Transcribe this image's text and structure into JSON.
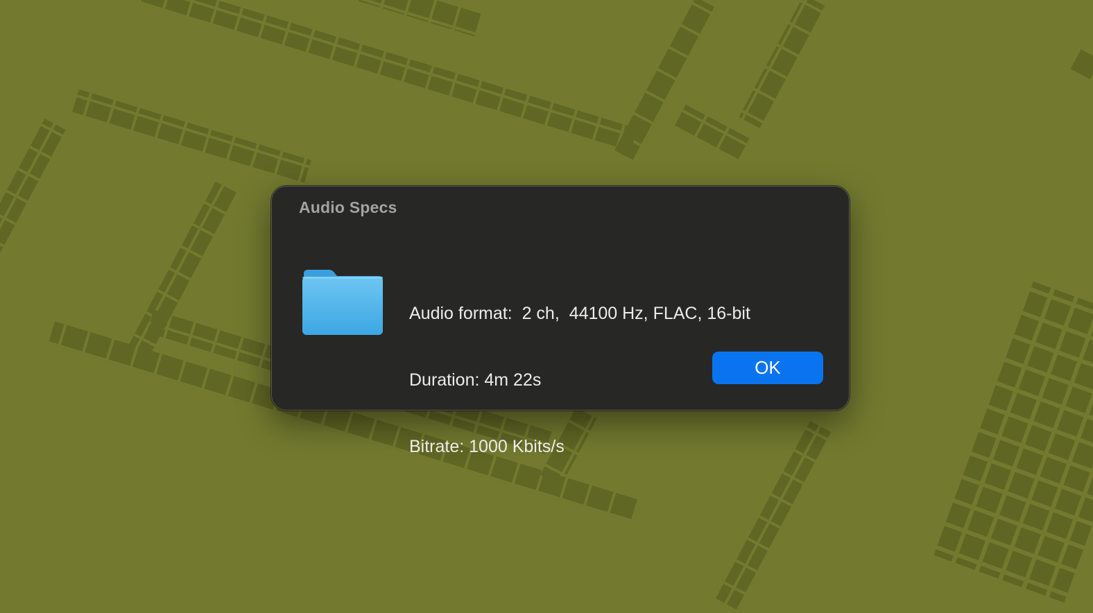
{
  "dialog": {
    "title": "Audio Specs",
    "icon": "folder-icon",
    "lines": [
      "Audio format:  2 ch,  44100 Hz, FLAC, 16-bit",
      "Duration: 4m 22s",
      "Bitrate: 1000 Kbits/s"
    ],
    "ok_label": "OK"
  },
  "colors": {
    "wallpaper": "#737a2f",
    "dialog_background": "#272725",
    "button_accent": "#0a74f0",
    "folder_blue": "#55b6ea"
  }
}
